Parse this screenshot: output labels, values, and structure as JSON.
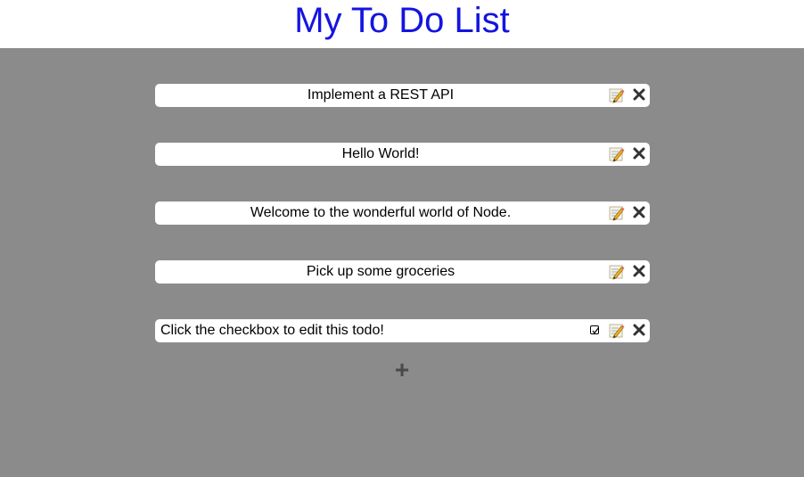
{
  "page": {
    "title": "My To Do List"
  },
  "todos": [
    {
      "text": "Implement a REST API",
      "editing": false
    },
    {
      "text": "Hello World!",
      "editing": false
    },
    {
      "text": "Welcome to the wonderful world of Node.",
      "editing": false
    },
    {
      "text": "Pick up some groceries",
      "editing": false
    },
    {
      "text": "Click the checkbox to edit this todo!",
      "editing": true
    }
  ],
  "icons": {
    "edit": "pencil-note-icon",
    "delete": "close-x-icon",
    "add": "plus-icon",
    "checkbox": "checkbox-checked-icon"
  },
  "actions": {
    "add_label": "+"
  },
  "colors": {
    "title": "#1414e0",
    "background": "#8b8b8b",
    "header": "#ffffff",
    "item": "#ffffff",
    "icon_dark": "#333333",
    "add": "#4a4a4a"
  }
}
